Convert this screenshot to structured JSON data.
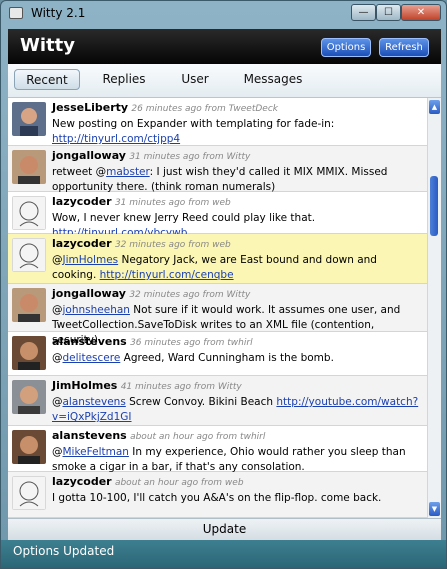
{
  "window": {
    "title": "Witty 2.1",
    "minimize": "—",
    "maximize": "☐",
    "close": "✕"
  },
  "header": {
    "logo": "Witty",
    "options_label": "Options",
    "refresh_label": "Refresh"
  },
  "tabs": [
    "Recent",
    "Replies",
    "User",
    "Messages"
  ],
  "tweets": [
    {
      "user": "JesseLiberty",
      "meta": "26 minutes ago from TweetDeck",
      "pre": "New posting on Expander with templating for fade-in: ",
      "link": "http://tinyurl.com/ctjpp4",
      "post": ""
    },
    {
      "user": "jongalloway",
      "meta": "31 minutes ago from Witty",
      "pre": "retweet @",
      "mention": "mabster",
      "mid": ": I just wish they'd called it MIX MMIX. Missed opportunity there. (think roman numerals)"
    },
    {
      "user": "lazycoder",
      "meta": "31 minutes ago from web",
      "pre": "Wow, I never knew Jerry Reed could play like that. ",
      "link": "http://tinyurl.com/ybcywb"
    },
    {
      "user": "lazycoder",
      "meta": "32 minutes ago from web",
      "mention": "JimHolmes",
      "pre": " Negatory Jack, we are East bound and down and cooking. ",
      "link": "http://tinyurl.com/cenqbe"
    },
    {
      "user": "jongalloway",
      "meta": "32 minutes ago from Witty",
      "mention": "johnsheehan",
      "pre": " Not sure if it would work. It assumes one user, and TweetCollection.SaveToDisk writes to an XML file (contention, security)."
    },
    {
      "user": "alanstevens",
      "meta": "36 minutes ago from twhirl",
      "mention": "delitescere",
      "pre": " Agreed, Ward Cunningham is the bomb."
    },
    {
      "user": "JimHolmes",
      "meta": "41 minutes ago from Witty",
      "mention": "alanstevens",
      "pre": " Screw Convoy.  Bikini Beach ",
      "link": "http://youtube.com/watch?v=iQxPkjZd1GI"
    },
    {
      "user": "alanstevens",
      "meta": "about an hour ago from twhirl",
      "mention": "MikeFeltman",
      "pre": " In my experience, Ohio would rather you sleep than smoke a cigar in a bar, if that's any consolation."
    },
    {
      "user": "lazycoder",
      "meta": "about an hour ago from web",
      "pre": "I gotta 10-100, I'll catch you A&A's on the flip-flop. come back."
    }
  ],
  "update_label": "Update",
  "status": "Options Updated",
  "colors": {
    "header_bg": "#050505",
    "highlight": "#fbf6b4",
    "link": "#1a3fb0",
    "status_bg": "#2b6676"
  }
}
